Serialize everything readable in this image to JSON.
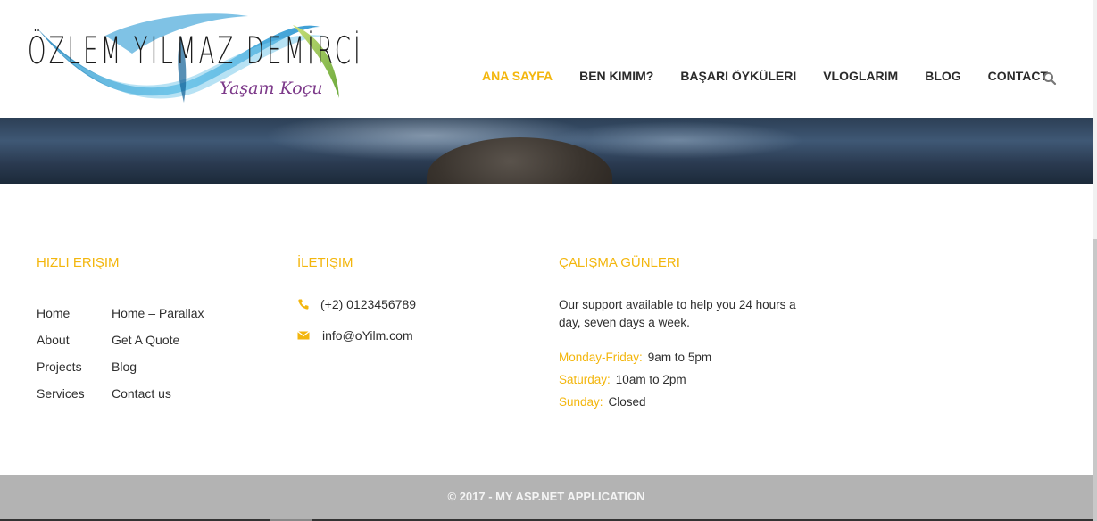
{
  "brand": {
    "name": "ÖZLEM YILMAZ DEMİRCİ",
    "tagline": "Yaşam Koçu",
    "colors": {
      "swoosh_blue": "#2f9fd4",
      "swoosh_green": "#8cc04b",
      "tagline_purple": "#7d3a8a"
    }
  },
  "nav": {
    "items": [
      {
        "label": "ANA SAYFA",
        "active": true
      },
      {
        "label": "BEN KIMIM?",
        "active": false
      },
      {
        "label": "BAŞARI ÖYKÜLERI",
        "active": false
      },
      {
        "label": "VLOGLARIM",
        "active": false
      },
      {
        "label": "BLOG",
        "active": false
      },
      {
        "label": "CONTACT",
        "active": false
      }
    ],
    "search_icon": "search-icon"
  },
  "footer": {
    "quick_links": {
      "heading": "HIZLI ERIŞIM",
      "col1": [
        "Home",
        "About",
        "Projects",
        "Services"
      ],
      "col2": [
        "Home – Parallax",
        "Get A Quote",
        "Blog",
        "Contact us"
      ]
    },
    "contact": {
      "heading": "İLETIŞIM",
      "phone": "(+2) 0123456789",
      "email": "info@oYilm.com",
      "phone_icon": "phone-icon",
      "email_icon": "envelope-icon"
    },
    "hours": {
      "heading": "ÇALIŞMA GÜNLERI",
      "text": "Our support available to help you 24 hours a day, seven days a week.",
      "rows": [
        {
          "day": "Monday-Friday:",
          "time": "9am to 5pm"
        },
        {
          "day": "Saturday:",
          "time": "10am to 2pm"
        },
        {
          "day": "Sunday:",
          "time": "Closed"
        }
      ]
    }
  },
  "copyright": "© 2017 - MY ASP.NET APPLICATION",
  "colors": {
    "accent": "#f3b60d",
    "bottom_bar": "#b3b3b3",
    "text": "#2f2f2f"
  }
}
